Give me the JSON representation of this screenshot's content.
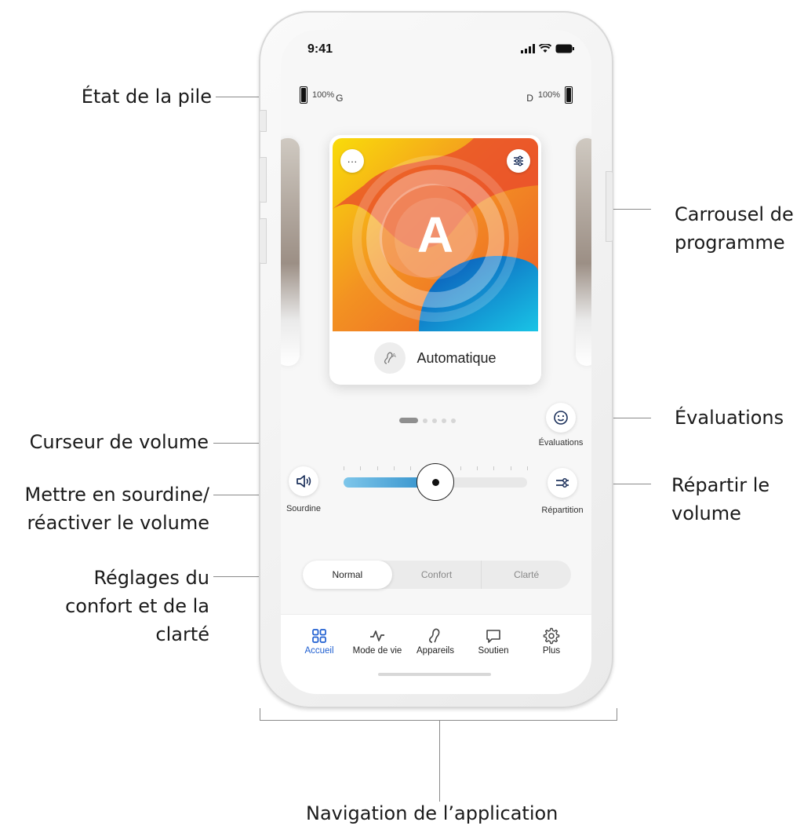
{
  "callouts": {
    "battery": "État de la pile",
    "carousel_line1": "Carrousel de",
    "carousel_line2": "programme",
    "ratings": "Évaluations",
    "volume_cursor": "Curseur de volume",
    "split_line1": "Répartir le",
    "split_line2": "volume",
    "mute_line1": "Mettre en sourdine/",
    "mute_line2": "réactiver le volume",
    "comfort_line1": "Réglages du",
    "comfort_line2": "confort et de la",
    "comfort_line3": "clarté",
    "navigation": "Navigation de l’application"
  },
  "status_bar": {
    "time": "9:41"
  },
  "battery": {
    "left": {
      "percent": "100%",
      "side": "G"
    },
    "right": {
      "percent": "100%",
      "side": "D"
    }
  },
  "program_card": {
    "more_label": "···",
    "letter": "A",
    "name": "Automatique",
    "icon": "ear-a-icon",
    "gradient_colors": [
      "#f6d200",
      "#f07a1f",
      "#e2382c",
      "#0f7fd6",
      "#1cc2e6"
    ]
  },
  "pager": {
    "active_index": 0,
    "count": 5
  },
  "ratings_button": {
    "label": "Évaluations",
    "icon": "smiley-icon"
  },
  "mute_button": {
    "label": "Sourdine",
    "icon": "speaker-icon"
  },
  "split_button": {
    "label": "Répartition",
    "icon": "sliders-icon"
  },
  "volume": {
    "level": 0.5
  },
  "sound_mode": {
    "options": [
      "Normal",
      "Confort",
      "Clarté"
    ],
    "selected": "Normal"
  },
  "tabbar": {
    "items": [
      {
        "label": "Accueil",
        "icon": "grid-icon",
        "active": true
      },
      {
        "label": "Mode de vie",
        "icon": "activity-icon",
        "active": false
      },
      {
        "label": "Appareils",
        "icon": "hearing-aid-icon",
        "active": false
      },
      {
        "label": "Soutien",
        "icon": "chat-icon",
        "active": false
      },
      {
        "label": "Plus",
        "icon": "gear-icon",
        "active": false
      }
    ]
  },
  "colors": {
    "accent": "#1f5fd1",
    "slider_fill": "#2a8bc8",
    "icon_navy": "#1a2f5a"
  }
}
